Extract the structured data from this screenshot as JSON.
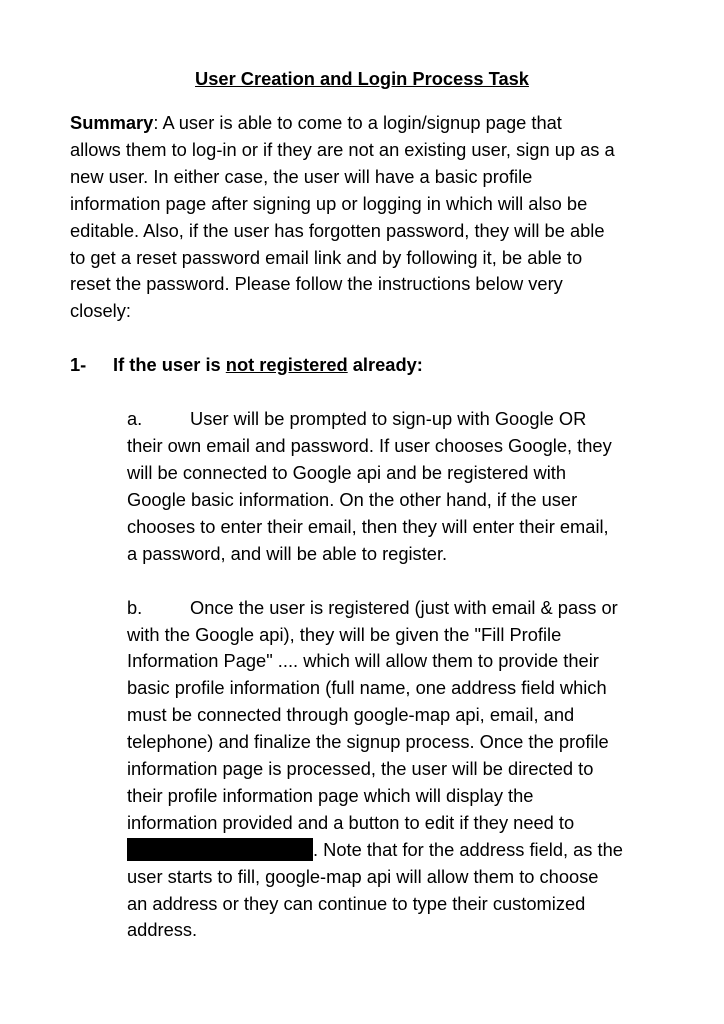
{
  "title": "User Creation and Login Process Task",
  "summary": {
    "label": "Summary",
    "line1_rest": ":  A user is able to come to a login/signup page that",
    "lines": [
      "allows them to log-in or if they are not an existing user, sign up as a",
      "new user. In either case, the user will have a basic profile",
      "information page after signing up or logging in which will also be",
      "editable. Also, if the user has forgotten password, they will be able",
      "to get a reset password email link and by following it, be able to",
      "reset the password. Please follow the instructions below very",
      "closely:"
    ]
  },
  "section1": {
    "number": "1-",
    "prefix": "If the user is ",
    "underlined": "not registered",
    "suffix": " already:"
  },
  "item_a": {
    "marker": "a.",
    "lines": [
      "User will be prompted to sign-up with Google OR",
      "their own email and password. If user chooses Google, they",
      "will be connected to Google api and be registered with",
      "Google basic information. On the other hand, if the user",
      "chooses to enter their email, then they will enter their email,",
      "a password, and will be able to register."
    ]
  },
  "item_b": {
    "marker": "b.",
    "lines": [
      "Once the user is registered (just with email & pass or",
      "with the Google api), they will be given the \"Fill Profile",
      "Information Page\" .... which will allow them to provide their",
      "basic profile information (full name, one address field which",
      "must be connected through google-map api, email, and",
      "telephone) and finalize the signup process. Once the profile",
      "information page is processed, the user will be directed to",
      "their profile information page which will display the",
      "information provided and a button to edit if they need to"
    ],
    "after_redaction": ". Note that for the address field, as the",
    "tail_lines": [
      "user starts to fill, google-map api will allow them to choose",
      "an address or they can continue to type their customized",
      "address."
    ]
  }
}
